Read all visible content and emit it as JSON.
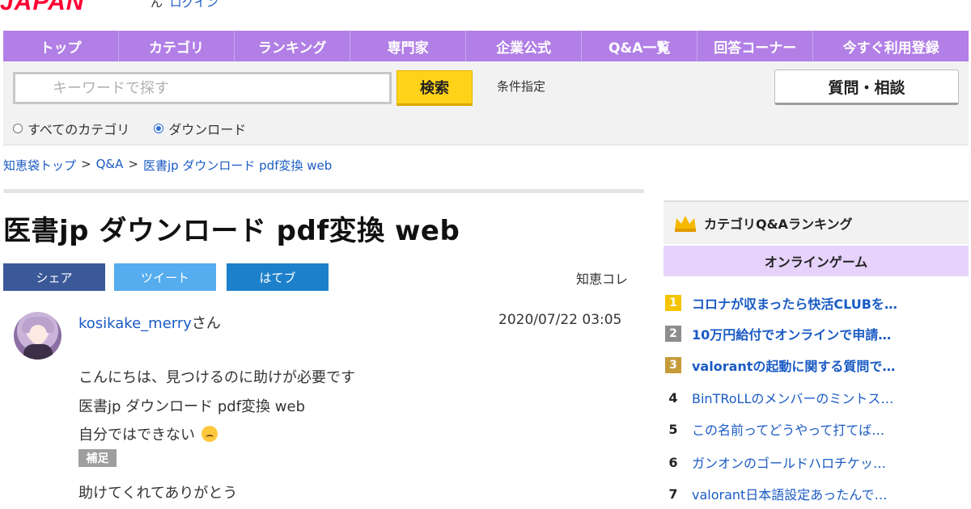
{
  "header": {
    "logo": "JAPAN",
    "login_prefix": "ん",
    "login_label": "ログイン"
  },
  "nav": {
    "items": [
      "トップ",
      "カテゴリ",
      "ランキング",
      "専門家",
      "企業公式",
      "Q&A一覧",
      "回答コーナー",
      "今すぐ利用登録"
    ]
  },
  "search": {
    "placeholder": "キーワードで探す",
    "button_label": "検索",
    "condition_label": "条件指定",
    "ask_button_label": "質問・相談",
    "scope_options": [
      "すべてのカテゴリ",
      "ダウンロード"
    ],
    "selected_scope": "ダウンロード"
  },
  "breadcrumb": {
    "items": [
      "知恵袋トップ",
      "Q&A",
      "医書jp ダウンロード pdf変換 web"
    ],
    "separator": ">"
  },
  "question": {
    "title": "医書jp ダウンロード pdf変換 web",
    "share_buttons": [
      "シェア",
      "ツイート",
      "はてブ"
    ],
    "chie_kore": "知恵コレ",
    "username": "kosikake_merry",
    "username_suffix": "さん",
    "timestamp": "2020/07/22 03:05",
    "body_lines": [
      "こんにちは、見つけるのに助けが必要です",
      "医書jp ダウンロード pdf変換 web",
      "自分ではできない"
    ],
    "supplement_tag": "補足",
    "supplement_text": "助けてくれてありがとう"
  },
  "sidebar": {
    "title": "カテゴリQ&Aランキング",
    "category": "オンラインゲーム",
    "ranking": [
      {
        "rank": "1",
        "text": "コロナが収まったら快活CLUBを…"
      },
      {
        "rank": "2",
        "text": "10万円給付でオンラインで申請…"
      },
      {
        "rank": "3",
        "text": "valorantの起動に関する質問で…"
      },
      {
        "rank": "4",
        "text": "BinTRoLLのメンバーのミントス…"
      },
      {
        "rank": "5",
        "text": "この名前ってどうやって打てば…"
      },
      {
        "rank": "6",
        "text": "ガンオンのゴールドハロチケッ…"
      },
      {
        "rank": "7",
        "text": "valorant日本語設定あったんで…"
      }
    ]
  },
  "colors": {
    "nav_bg": "#b17fe6",
    "search_button": "#ffd21a",
    "link": "#1a5bc4",
    "ranking_sub_bg": "#e6d2fb",
    "rank1": "#f6c400",
    "rank2": "#8d8d8d",
    "rank3": "#c69b3a"
  },
  "icons": {
    "ranking_header": "crown-icon",
    "emoji": "crying-face-emoji"
  }
}
